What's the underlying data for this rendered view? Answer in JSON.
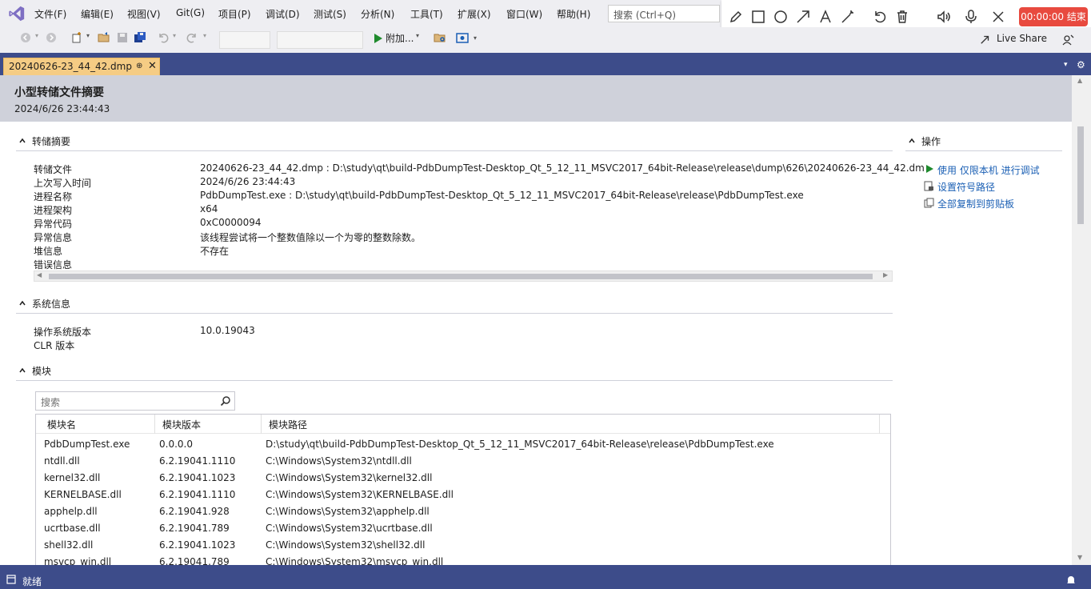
{
  "menu": {
    "items": [
      "文件(F)",
      "编辑(E)",
      "视图(V)",
      "Git(G)",
      "项目(P)",
      "调试(D)",
      "测试(S)",
      "分析(N)",
      "工具(T)",
      "扩展(X)",
      "窗口(W)",
      "帮助(H)"
    ],
    "search_placeholder": "搜索 (Ctrl+Q)"
  },
  "recorder": {
    "timer_label": "00:00:00 结束"
  },
  "toolbar": {
    "attach_label": "附加...",
    "live_share_label": "Live Share"
  },
  "tab": {
    "label": "20240626-23_44_42.dmp",
    "pin_glyph": "⊕",
    "close_glyph": "✕"
  },
  "document": {
    "title": "小型转储文件摘要",
    "date": "2024/6/26 23:44:43"
  },
  "dump_summary": {
    "heading": "转储摘要",
    "rows": [
      {
        "key": "转储文件",
        "value": "20240626-23_44_42.dmp : D:\\study\\qt\\build-PdbDumpTest-Desktop_Qt_5_12_11_MSVC2017_64bit-Release\\release\\dump\\626\\20240626-23_44_42.dm"
      },
      {
        "key": "上次写入时间",
        "value": "2024/6/26 23:44:43"
      },
      {
        "key": "进程名称",
        "value": "PdbDumpTest.exe : D:\\study\\qt\\build-PdbDumpTest-Desktop_Qt_5_12_11_MSVC2017_64bit-Release\\release\\PdbDumpTest.exe"
      },
      {
        "key": "进程架构",
        "value": "x64"
      },
      {
        "key": "异常代码",
        "value": "0xC0000094"
      },
      {
        "key": "异常信息",
        "value": "该线程尝试将一个整数值除以一个为零的整数除数。"
      },
      {
        "key": "堆信息",
        "value": "不存在"
      },
      {
        "key": "错误信息",
        "value": ""
      }
    ]
  },
  "system_info": {
    "heading": "系统信息",
    "rows": [
      {
        "key": "操作系统版本",
        "value": "10.0.19043"
      },
      {
        "key": "CLR 版本",
        "value": ""
      }
    ]
  },
  "actions": {
    "heading": "操作",
    "items": [
      "使用 仅限本机 进行调试",
      "设置符号路径",
      "全部复制到剪贴板"
    ]
  },
  "modules": {
    "heading": "模块",
    "search_placeholder": "搜索",
    "columns": [
      "模块名",
      "模块版本",
      "模块路径"
    ],
    "rows": [
      [
        "PdbDumpTest.exe",
        "0.0.0.0",
        "D:\\study\\qt\\build-PdbDumpTest-Desktop_Qt_5_12_11_MSVC2017_64bit-Release\\release\\PdbDumpTest.exe"
      ],
      [
        "ntdll.dll",
        "6.2.19041.1110",
        "C:\\Windows\\System32\\ntdll.dll"
      ],
      [
        "kernel32.dll",
        "6.2.19041.1023",
        "C:\\Windows\\System32\\kernel32.dll"
      ],
      [
        "KERNELBASE.dll",
        "6.2.19041.1110",
        "C:\\Windows\\System32\\KERNELBASE.dll"
      ],
      [
        "apphelp.dll",
        "6.2.19041.928",
        "C:\\Windows\\System32\\apphelp.dll"
      ],
      [
        "ucrtbase.dll",
        "6.2.19041.789",
        "C:\\Windows\\System32\\ucrtbase.dll"
      ],
      [
        "shell32.dll",
        "6.2.19041.1023",
        "C:\\Windows\\System32\\shell32.dll"
      ],
      [
        "msvcp_win.dll",
        "6.2.19041.789",
        "C:\\Windows\\System32\\msvcp_win.dll"
      ]
    ]
  },
  "status": {
    "text": "就绪"
  },
  "colors": {
    "accent": "#3d4c8a",
    "tab_active": "#f5cc84",
    "header_band": "#cfd1da",
    "link": "#1a5fb4",
    "play_green": "#1f8a2d",
    "record_red": "#e84a3f"
  }
}
